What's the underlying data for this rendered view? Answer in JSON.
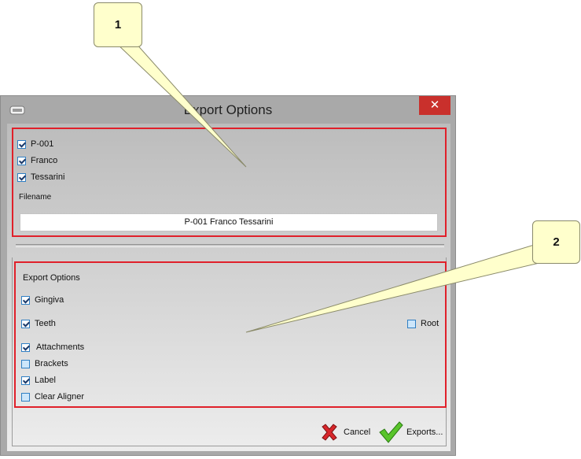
{
  "window": {
    "title": "Export Options",
    "close_glyph": "✕"
  },
  "name_fields": {
    "items": [
      {
        "label": "P-001",
        "checked": true
      },
      {
        "label": "Franco",
        "checked": true
      },
      {
        "label": "Tessarini",
        "checked": true
      }
    ],
    "filename_label": "Filename",
    "filename_value": "P-001 Franco Tessarini"
  },
  "export_options": {
    "heading": "Export Options",
    "gingiva": {
      "label": "Gingiva",
      "checked": true
    },
    "teeth": {
      "label": "Teeth",
      "checked": true
    },
    "root": {
      "label": "Root",
      "checked": false
    },
    "attachments": {
      "label": "Attachments",
      "checked": true
    },
    "brackets": {
      "label": "Brackets",
      "checked": false
    },
    "label": {
      "label": "Label",
      "checked": true
    },
    "clear_aligner": {
      "label": "Clear Aligner",
      "checked": false
    }
  },
  "buttons": {
    "cancel": "Cancel",
    "exports": "Exports..."
  },
  "callouts": {
    "one": "1",
    "two": "2"
  },
  "colors": {
    "highlight": "#e0202a",
    "callout_fill": "#ffffcc",
    "close": "#c9302c"
  },
  "icons": [
    "app-icon",
    "close-icon",
    "cancel-x-icon",
    "checkmark-icon"
  ]
}
